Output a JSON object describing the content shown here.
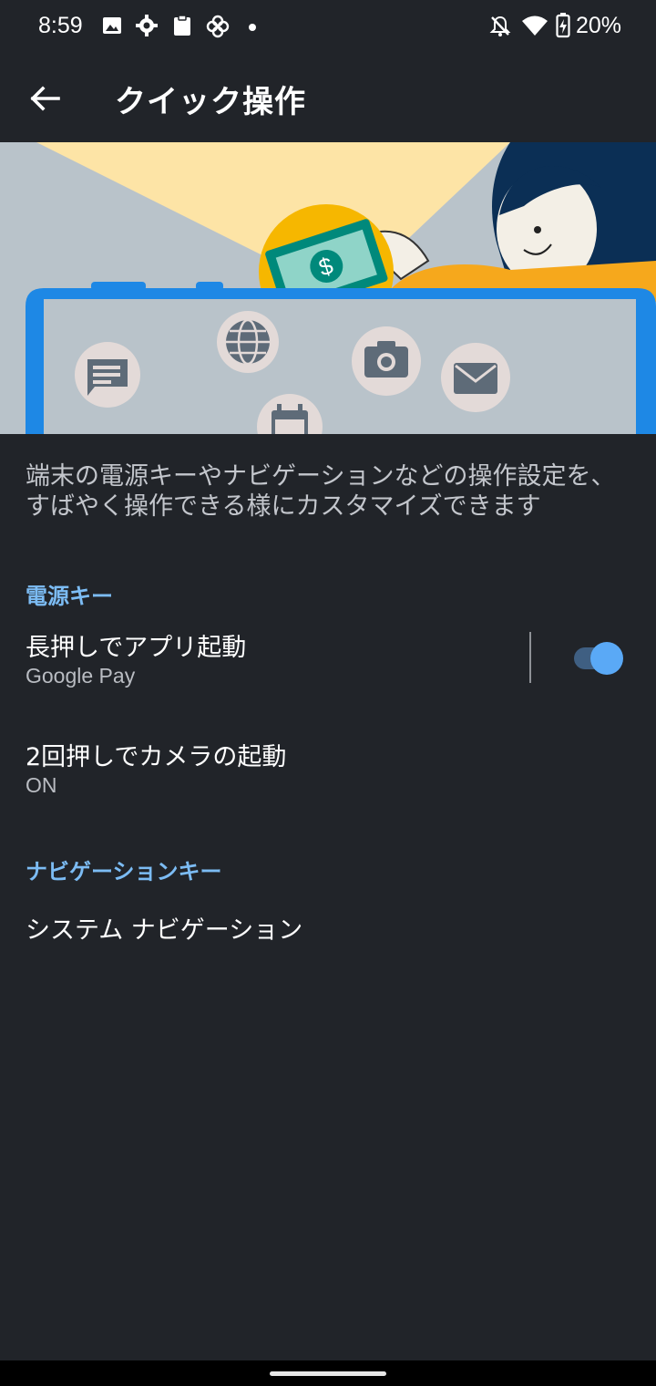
{
  "status": {
    "time": "8:59",
    "battery": "20%",
    "left_icons": [
      "gallery-icon",
      "settings-gear-icon",
      "clipboard-icon",
      "pinwheel-icon",
      "notification-dot-icon"
    ],
    "right_icons": [
      "bell-off-icon",
      "wifi-icon",
      "battery-charging-icon"
    ]
  },
  "appbar": {
    "title": "クイック操作",
    "back_icon": "arrow-back-icon"
  },
  "illustration": {
    "icons": [
      "chat-icon",
      "globe-icon",
      "camera-icon",
      "mail-icon",
      "calendar-icon",
      "money-icon"
    ],
    "colors": {
      "frame": "#1e88e5",
      "beam": "#fde4a6",
      "coin": "#f6b700",
      "bill": "#00897b"
    }
  },
  "description": "端末の電源キーやナビゲーションなどの操作設定を、すばやく操作できる様にカスタマイズできます",
  "sections": {
    "power": {
      "header": "電源キー",
      "long_press": {
        "title": "長押しでアプリ起動",
        "subtitle": "Google Pay",
        "toggle_on": true
      },
      "double_press": {
        "title": "2回押しでカメラの起動",
        "subtitle": "ON"
      }
    },
    "navigation": {
      "header": "ナビゲーションキー",
      "system_nav": {
        "title": "システム ナビゲーション"
      }
    }
  },
  "colors": {
    "background": "#212429",
    "accent": "#7cbcf4",
    "toggle_thumb": "#5aa9f6"
  }
}
